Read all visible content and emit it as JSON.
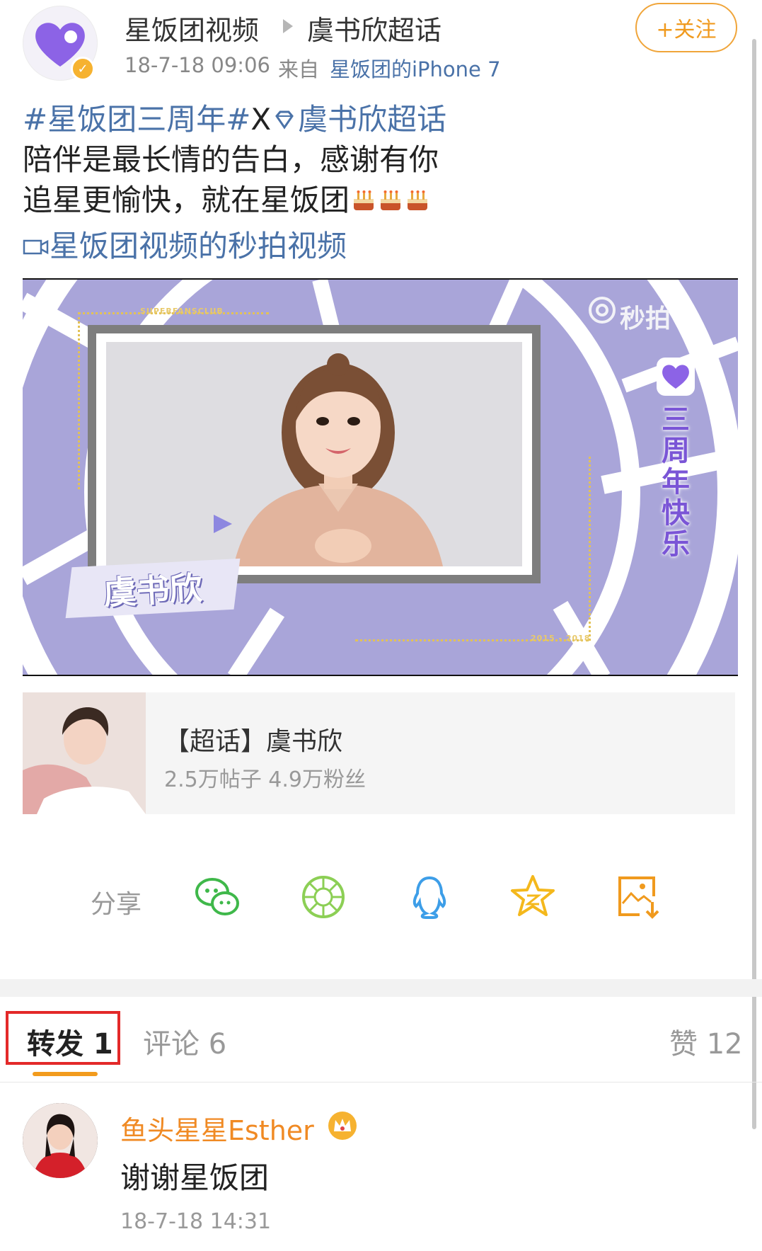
{
  "header": {
    "username": "星饭团视频",
    "topic": "虞书欣超话",
    "follow_label": "+关注",
    "time": "18-7-18 09:06",
    "from_label": "来自",
    "device": "星饭团的iPhone 7",
    "verified_icon": "verified-badge-icon"
  },
  "post": {
    "hashtag": "#星饭团三周年#",
    "x_char": "X",
    "topic_link": "虞书欣超话",
    "line2": "陪伴是最长情的告白，感谢有你",
    "line3": "追星更愉快，就在星饭团",
    "video_link": "星饭团视频的秒拍视频"
  },
  "video": {
    "watermark": "秒拍",
    "name_tag": "虞书欣",
    "anniversary": "三周年快乐",
    "club_text": "SUPERFANSCLUB",
    "years_text": "2015 - 2018"
  },
  "topic_card": {
    "title": "【超话】虞书欣",
    "stats": "2.5万帖子 4.9万粉丝"
  },
  "share": {
    "label": "分享",
    "icons": [
      "wechat-icon",
      "moments-icon",
      "qq-icon",
      "qzone-icon",
      "save-image-icon"
    ]
  },
  "tabs": {
    "repost": "转发 1",
    "comment": "评论 6",
    "like": "赞 12"
  },
  "repost_item": {
    "name": "鱼头星星Esther",
    "text": "谢谢星饭团",
    "time": "18-7-18 14:31"
  },
  "colors": {
    "link": "#4a72a8",
    "accent": "#f09a1e",
    "highlight_box": "#e32929",
    "video_bg": "#a9a5d9"
  }
}
